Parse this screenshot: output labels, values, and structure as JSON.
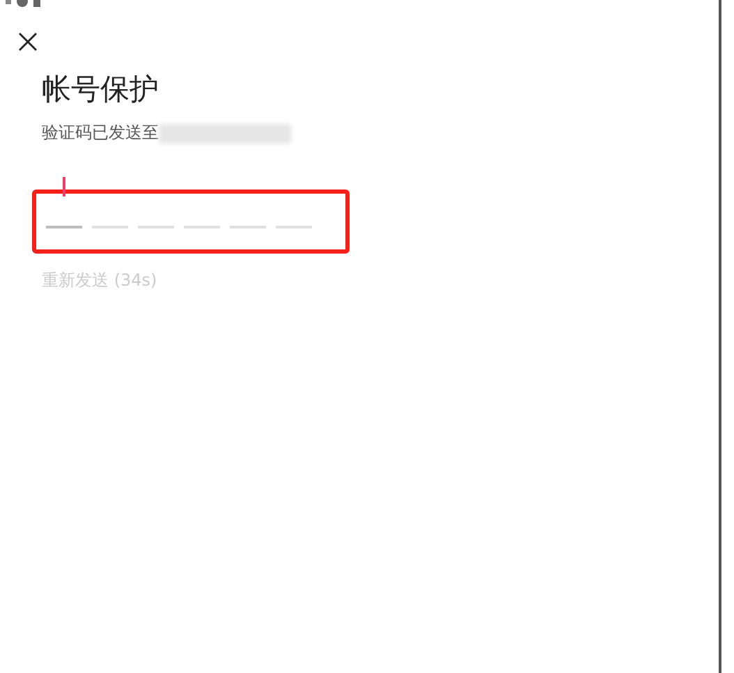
{
  "title": "帐号保护",
  "sent_label": "验证码已发送至",
  "code_slots": [
    {
      "active": true
    },
    {
      "active": false
    },
    {
      "active": false
    },
    {
      "active": false
    },
    {
      "active": false
    },
    {
      "active": false
    }
  ],
  "resend": {
    "label": "重新发送 (34s)",
    "disabled": true
  }
}
